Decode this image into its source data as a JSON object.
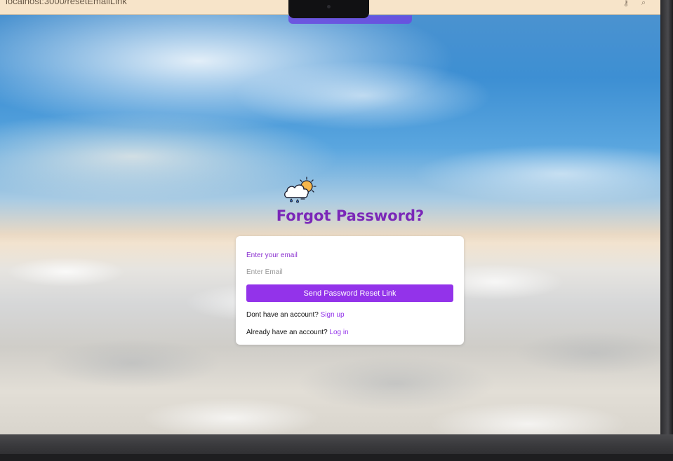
{
  "browser": {
    "url": "localhost:3000/resetEmailLink"
  },
  "page": {
    "title": "Forgot Password?"
  },
  "form": {
    "email_label": "Enter your email",
    "email_placeholder": "Enter Email",
    "email_value": "",
    "submit_label": "Send Password Reset Link"
  },
  "links": {
    "signup_prompt": "Dont have an account?",
    "signup_link": "Sign up",
    "login_prompt": "Already have an account?",
    "login_link": "Log in"
  },
  "icons": {
    "logo": "weather-cloud-sun-icon",
    "strip_right_1": "key-icon",
    "strip_right_2": "search-icon"
  },
  "colors": {
    "accent": "#9333ea",
    "title": "#7a27b8",
    "card": "#ffffff"
  }
}
